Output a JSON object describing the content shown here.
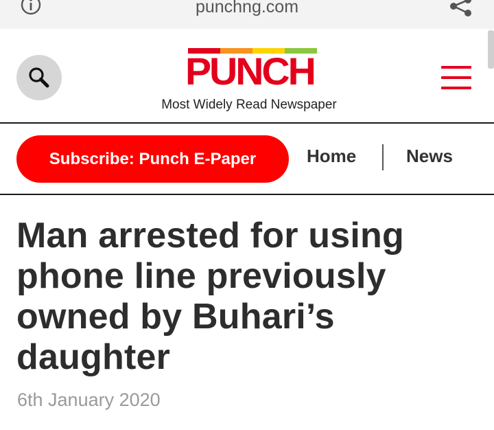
{
  "browser": {
    "url": "punchng.com",
    "icons": [
      "info-icon",
      "share-icon"
    ]
  },
  "masthead": {
    "logo_text": "PUNCH",
    "logo_stripe_colors": [
      "#e3001b",
      "#f7931e",
      "#ffd400",
      "#8cc63f"
    ],
    "tagline": "Most Widely Read Newspaper",
    "search_icon": "search-icon",
    "menu_icon": "hamburger-menu-icon"
  },
  "nav": {
    "subscribe_label": "Subscribe: Punch E-Paper",
    "links": [
      "Home",
      "News"
    ]
  },
  "article": {
    "headline": "Man arrested for using phone line previously owned by Buhari’s daughter",
    "date": "6th January 2020"
  },
  "colors": {
    "brand_red": "#e3001b",
    "button_red": "#ff0000",
    "headline_text": "#2d2d2d",
    "date_text": "#9a9a9a"
  }
}
